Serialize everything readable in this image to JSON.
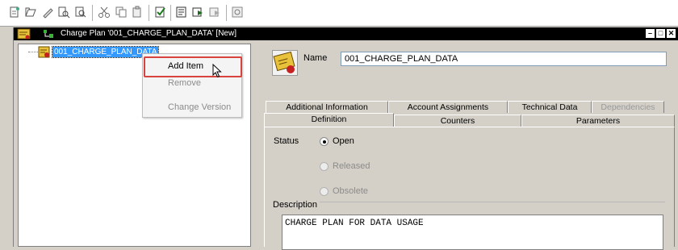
{
  "toolbar": {
    "buttons": [
      "new-icon",
      "open-icon",
      "edit-icon",
      "find-icon",
      "search-icon",
      "cut-icon",
      "copy-icon",
      "paste-icon",
      "validate-icon",
      "report-icon",
      "view-icon",
      "print-icon",
      "settings-icon"
    ]
  },
  "window": {
    "title": "Charge Plan '001_CHARGE_PLAN_DATA' [New]",
    "controls": [
      "minimize",
      "restore",
      "close"
    ]
  },
  "tree": {
    "items": [
      {
        "label": "001_CHARGE_PLAN_DATA",
        "selected": true
      }
    ]
  },
  "context_menu": {
    "items": [
      {
        "label": "Add Item",
        "enabled": true
      },
      {
        "label": "Remove",
        "enabled": false
      },
      {
        "label": "Change Version",
        "enabled": false
      }
    ]
  },
  "form": {
    "name_label": "Name",
    "name_value": "001_CHARGE_PLAN_DATA",
    "tabs_row1": [
      {
        "label": "Additional Information",
        "enabled": true
      },
      {
        "label": "Account Assignments",
        "enabled": true
      },
      {
        "label": "Technical Data",
        "enabled": true
      },
      {
        "label": "Dependencies",
        "enabled": false
      }
    ],
    "tabs_row2": [
      {
        "label": "Definition",
        "active": true
      },
      {
        "label": "Counters",
        "active": false
      },
      {
        "label": "Parameters",
        "active": false
      }
    ],
    "status_label": "Status",
    "status_options": [
      {
        "label": "Open",
        "checked": true,
        "enabled": true
      },
      {
        "label": "Released",
        "checked": false,
        "enabled": false
      },
      {
        "label": "Obsolete",
        "checked": false,
        "enabled": false
      }
    ],
    "description_label": "Description",
    "description_value": "CHARGE PLAN FOR DATA USAGE"
  },
  "colors": {
    "selection": "#3399ff",
    "highlight_box": "#d9433d",
    "titlebar": "#000000"
  }
}
